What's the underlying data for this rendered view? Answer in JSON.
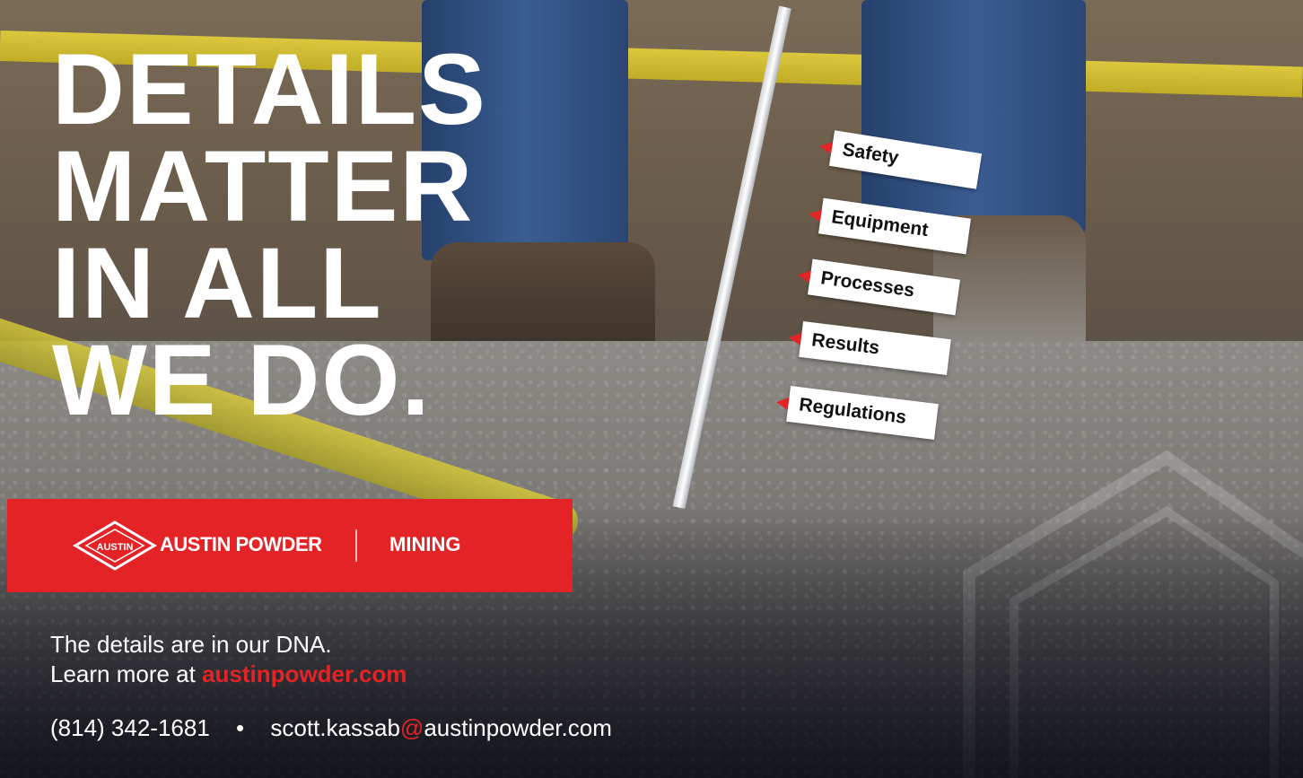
{
  "headline": [
    "DETAILS",
    "MATTER",
    "IN ALL",
    "WE DO."
  ],
  "tags": [
    "Safety",
    "Equipment",
    "Processes",
    "Results",
    "Regulations"
  ],
  "brand": {
    "name": "AUSTIN POWDER",
    "division": "MINING",
    "logo_text": "AUSTIN",
    "accent_color": "#e32326"
  },
  "tagline": {
    "line1": "The details are in our DNA.",
    "line2_prefix": "Learn more at ",
    "domain_strong": "austinpowder",
    "domain_tld": ".com"
  },
  "contact": {
    "phone": "(814) 342-1681",
    "separator": "•",
    "email_user": "scott.kassab",
    "email_at": "@",
    "email_domain": "austinpowder.com"
  }
}
